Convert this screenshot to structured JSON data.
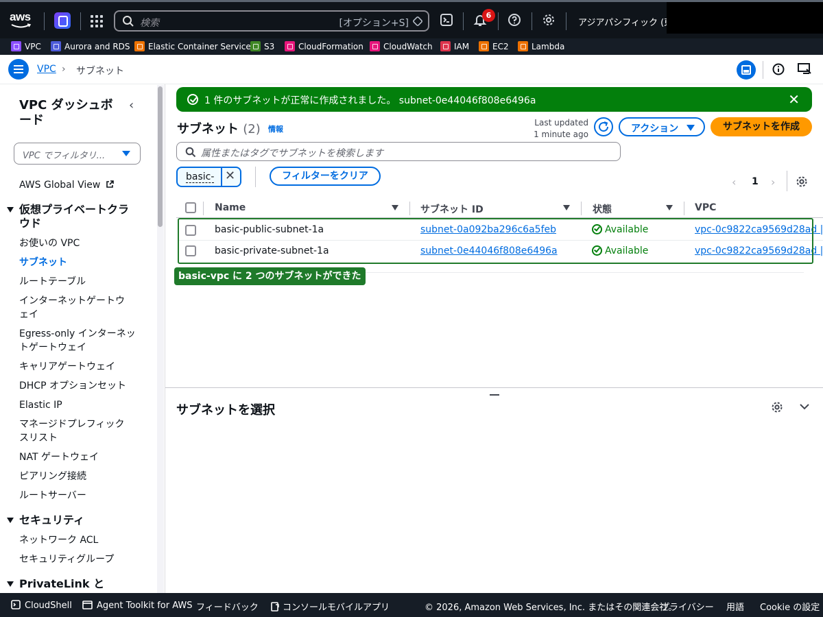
{
  "topnav": {
    "logo_text": "aws",
    "search_placeholder": "検索",
    "search_shortcut": "[オプション+S]",
    "notification_count": "6",
    "region": "アジアパシフィック (東京)"
  },
  "favorites": [
    {
      "label": "VPC",
      "color": "#8c4fff"
    },
    {
      "label": "Aurora and RDS",
      "color": "#4d5bd9"
    },
    {
      "label": "Elastic Container Service",
      "color": "#ed7100"
    },
    {
      "label": "S3",
      "color": "#3f8624"
    },
    {
      "label": "CloudFormation",
      "color": "#e7157b"
    },
    {
      "label": "CloudWatch",
      "color": "#e7157b"
    },
    {
      "label": "IAM",
      "color": "#dd344c"
    },
    {
      "label": "EC2",
      "color": "#ed7100"
    },
    {
      "label": "Lambda",
      "color": "#ed7100"
    }
  ],
  "breadcrumb": {
    "root": "VPC",
    "current": "サブネット"
  },
  "sidebar": {
    "title": "VPC ダッシュボード",
    "filter_placeholder": "VPC でフィルタリ...",
    "global_view": "AWS Global View",
    "sections": [
      {
        "title": "仮想プライベートクラウド",
        "items": [
          "お使いの VPC",
          "サブネット",
          "ルートテーブル",
          "インターネットゲートウェイ",
          "Egress-only インターネットゲートウェイ",
          "キャリアゲートウェイ",
          "DHCP オプションセット",
          "Elastic IP",
          "マネージドプレフィックスリスト",
          "NAT ゲートウェイ",
          "ピアリング接続",
          "ルートサーバー"
        ]
      },
      {
        "title": "セキュリティ",
        "items": [
          "ネットワーク ACL",
          "セキュリティグループ"
        ]
      },
      {
        "title": "PrivateLink と Lattice",
        "items": []
      }
    ]
  },
  "flash": {
    "message": "1 件のサブネットが正常に作成されました。 subnet-0e44046f808e6496a"
  },
  "table_header": {
    "title": "サブネット",
    "count": "(2)",
    "info": "情報",
    "last_updated_1": "Last updated",
    "last_updated_2": "1 minute ago",
    "actions": "アクション",
    "create": "サブネットを作成",
    "search_placeholder": "属性またはタグでサブネットを検索します",
    "filter_token": "basic-",
    "clear_filters": "フィルターをクリア",
    "page": "1"
  },
  "columns": [
    "Name",
    "サブネット ID",
    "状態",
    "VPC"
  ],
  "rows": [
    {
      "name": "basic-public-subnet-1a",
      "subnet_id": "subnet-0a092ba296c6a5feb",
      "state": "Available",
      "vpc": "vpc-0c9822ca9569d28ad |"
    },
    {
      "name": "basic-private-subnet-1a",
      "subnet_id": "subnet-0e44046f808e6496a",
      "state": "Available",
      "vpc": "vpc-0c9822ca9569d28ad |"
    }
  ],
  "annotation": "basic-vpc に 2 つのサブネットができた",
  "split_panel": {
    "title": "サブネットを選択"
  },
  "footer": {
    "cloudshell": "CloudShell",
    "agent_toolkit": "Agent Toolkit for AWS",
    "feedback": "フィードバック",
    "mobile_app": "コンソールモバイルアプリ",
    "copyright": "© 2026, Amazon Web Services, Inc. またはその関連会社。",
    "privacy": "プライバシー",
    "terms": "用語",
    "cookie": "Cookie の設定"
  },
  "colors": {
    "accent": "#006ce0",
    "success": "#037f0c",
    "primary_button": "#ff9900",
    "nav_bg": "#0f141a"
  }
}
